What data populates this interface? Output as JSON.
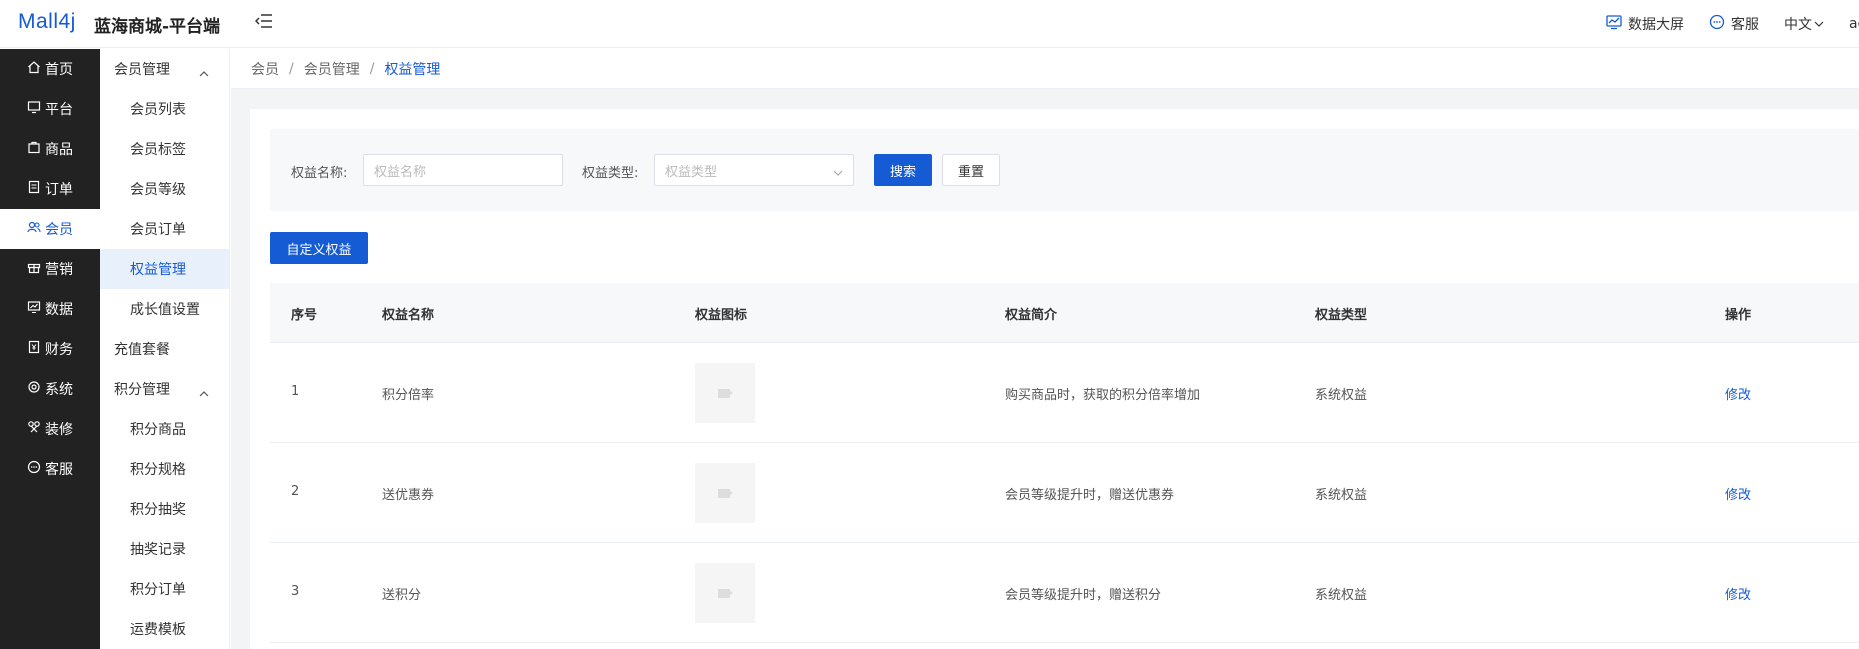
{
  "header": {
    "logo": "Mall4j",
    "title": "蓝海商城-平台端",
    "data_screen": "数据大屏",
    "service": "客服",
    "language": "中文",
    "user": "ad"
  },
  "primary_nav": [
    {
      "label": "首页",
      "icon": "home-icon"
    },
    {
      "label": "平台",
      "icon": "monitor-icon"
    },
    {
      "label": "商品",
      "icon": "bag-icon"
    },
    {
      "label": "订单",
      "icon": "document-icon"
    },
    {
      "label": "会员",
      "icon": "users-icon",
      "active": true
    },
    {
      "label": "营销",
      "icon": "gift-icon"
    },
    {
      "label": "数据",
      "icon": "chart-icon"
    },
    {
      "label": "财务",
      "icon": "finance-icon"
    },
    {
      "label": "系统",
      "icon": "settings-icon"
    },
    {
      "label": "装修",
      "icon": "decorate-icon"
    },
    {
      "label": "客服",
      "icon": "chat-icon"
    }
  ],
  "secondary_nav": {
    "group1": "会员管理",
    "items1": [
      "会员列表",
      "会员标签",
      "会员等级",
      "会员订单",
      "权益管理",
      "成长值设置"
    ],
    "standalone": "充值套餐",
    "group2": "积分管理",
    "items2": [
      "积分商品",
      "积分规格",
      "积分抽奖",
      "抽奖记录",
      "积分订单",
      "运费模板"
    ]
  },
  "breadcrumb": [
    "会员",
    "会员管理",
    "权益管理"
  ],
  "search": {
    "name_label": "权益名称:",
    "name_placeholder": "权益名称",
    "type_label": "权益类型:",
    "type_placeholder": "权益类型",
    "search_button": "搜索",
    "reset_button": "重置"
  },
  "custom_button": "自定义权益",
  "table": {
    "headers": [
      "序号",
      "权益名称",
      "权益图标",
      "权益简介",
      "权益类型",
      "操作"
    ],
    "rows": [
      {
        "index": "1",
        "name": "积分倍率",
        "desc": "购买商品时，获取的积分倍率增加",
        "type": "系统权益",
        "action": "修改"
      },
      {
        "index": "2",
        "name": "送优惠券",
        "desc": "会员等级提升时，赠送优惠券",
        "type": "系统权益",
        "action": "修改"
      },
      {
        "index": "3",
        "name": "送积分",
        "desc": "会员等级提升时，赠送积分",
        "type": "系统权益",
        "action": "修改"
      }
    ]
  },
  "colors": {
    "accent": "#155bd4",
    "sidebar_bg": "#222222"
  }
}
